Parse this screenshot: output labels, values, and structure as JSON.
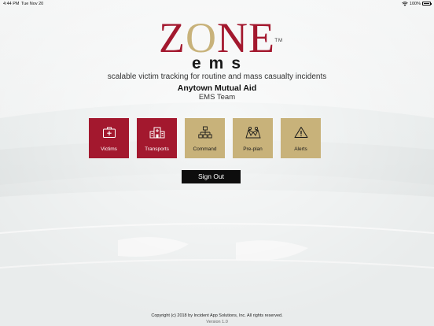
{
  "status_bar": {
    "time": "4:44 PM",
    "date": "Tue Nov 20",
    "battery": "100%"
  },
  "logo": {
    "zone_z": "Z",
    "zone_o": "O",
    "zone_ne": "NE",
    "tm": "TM",
    "ems": "ems"
  },
  "tagline": "scalable victim tracking for routine and mass casualty incidents",
  "organization": "Anytown Mutual Aid",
  "team": "EMS Team",
  "tiles": [
    {
      "label": "Victims",
      "icon": "first-aid-kit-icon"
    },
    {
      "label": "Transports",
      "icon": "hospital-icon"
    },
    {
      "label": "Command",
      "icon": "org-chart-icon"
    },
    {
      "label": "Pre-plan",
      "icon": "plan-map-icon"
    },
    {
      "label": "Alerts",
      "icon": "warning-icon"
    }
  ],
  "sign_out_label": "Sign Out",
  "footer": {
    "copyright": "Copyright (c) 2018 by Incident App Solutions, Inc. All rights reserved.",
    "version": "Version 1.0"
  },
  "colors": {
    "brand_red": "#a3182e",
    "brand_gold": "#c8b27a",
    "button_black": "#0d0d0d"
  }
}
